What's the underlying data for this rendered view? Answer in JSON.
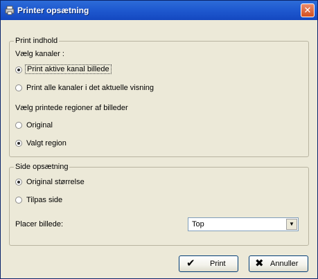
{
  "window": {
    "title": "Printer opsætning",
    "close_symbol": "✕"
  },
  "print_content": {
    "group_label": "Print indhold",
    "channels_label": "Vælg kanaler :",
    "channel_options": [
      {
        "label": "Print aktive kanal billede",
        "checked": true
      },
      {
        "label": "Print alle kanaler i det aktuelle visning",
        "checked": false
      }
    ],
    "regions_label": "Vælg printede regioner af billeder",
    "region_options": [
      {
        "label": "Original",
        "checked": false
      },
      {
        "label": "Valgt region",
        "checked": true
      }
    ]
  },
  "page_setup": {
    "group_label": "Side opsætning",
    "size_options": [
      {
        "label": "Original størrelse",
        "checked": true
      },
      {
        "label": "Tilpas side",
        "checked": false
      }
    ],
    "placement_label": "Placer billede:",
    "placement_value": "Top",
    "dropdown_arrow": "▼"
  },
  "buttons": {
    "print_label": "Print",
    "print_icon": "✔",
    "cancel_label": "Annuller",
    "cancel_icon": "✖"
  }
}
